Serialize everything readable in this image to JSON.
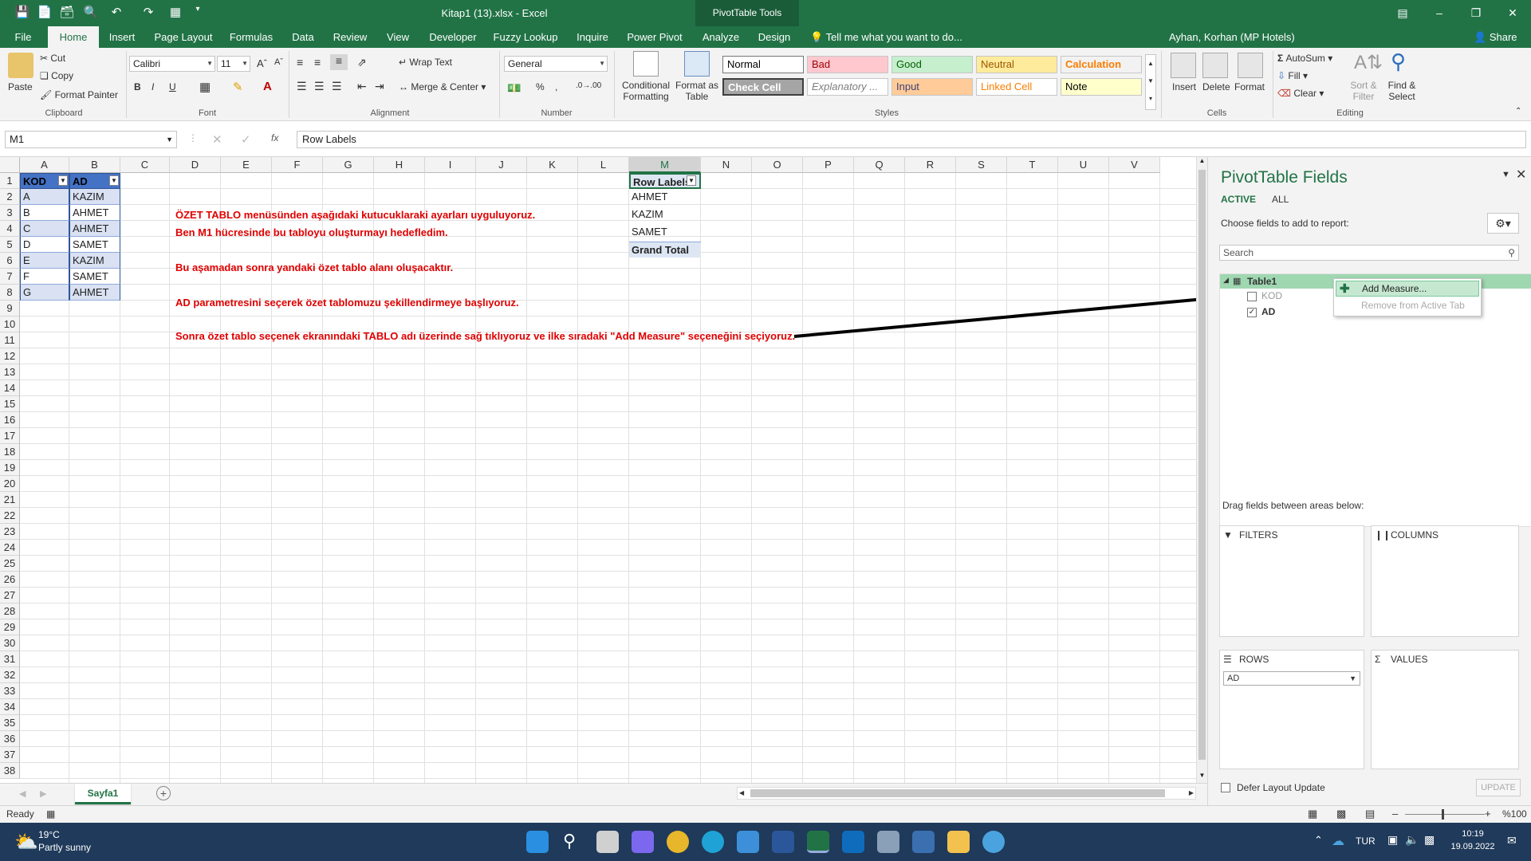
{
  "window": {
    "title": "Kitap1 (13).xlsx - Excel",
    "context_tab": "PivotTable Tools",
    "user": "Ayhan, Korhan (MP Hotels)",
    "share": "Share"
  },
  "ribbon_tabs": [
    "File",
    "Home",
    "Insert",
    "Page Layout",
    "Formulas",
    "Data",
    "Review",
    "View",
    "Developer",
    "Fuzzy Lookup",
    "Inquire",
    "Power Pivot",
    "Analyze",
    "Design"
  ],
  "tellme_placeholder": "Tell me what you want to do...",
  "ribbon": {
    "clipboard": {
      "paste": "Paste",
      "cut": "Cut",
      "copy": "Copy",
      "format_painter": "Format Painter",
      "label": "Clipboard"
    },
    "font": {
      "name": "Calibri",
      "size": "11",
      "label": "Font",
      "bold": "B",
      "italic": "I",
      "underline": "U"
    },
    "alignment": {
      "wrap": "Wrap Text",
      "merge": "Merge & Center",
      "label": "Alignment"
    },
    "number": {
      "format": "General",
      "percent": "%",
      "comma": ",",
      "label": "Number"
    },
    "styles": {
      "conditional": "Conditional Formatting",
      "format_table": "Format as Table",
      "label": "Styles",
      "cells": [
        {
          "name": "Normal",
          "bg": "#ffffff",
          "fg": "#000000"
        },
        {
          "name": "Bad",
          "bg": "#ffc7ce",
          "fg": "#9c0006"
        },
        {
          "name": "Good",
          "bg": "#c6efce",
          "fg": "#006100"
        },
        {
          "name": "Neutral",
          "bg": "#ffeb9c",
          "fg": "#9c5700"
        },
        {
          "name": "Calculation",
          "bg": "#f2f2f2",
          "fg": "#fa7d00"
        },
        {
          "name": "Check Cell",
          "bg": "#a5a5a5",
          "fg": "#ffffff"
        },
        {
          "name": "Explanatory ...",
          "bg": "#ffffff",
          "fg": "#7f7f7f"
        },
        {
          "name": "Input",
          "bg": "#ffcc99",
          "fg": "#3f3f76"
        },
        {
          "name": "Linked Cell",
          "bg": "#ffffff",
          "fg": "#fa7d00"
        },
        {
          "name": "Note",
          "bg": "#ffffcc",
          "fg": "#000000"
        }
      ]
    },
    "cells": {
      "insert": "Insert",
      "delete": "Delete",
      "format": "Format",
      "label": "Cells"
    },
    "editing": {
      "autosum": "AutoSum",
      "fill": "Fill",
      "clear": "Clear",
      "sort": "Sort & Filter",
      "find": "Find & Select",
      "label": "Editing"
    }
  },
  "formula_bar": {
    "name_box": "M1",
    "fx": "fx",
    "formula": "Row Labels"
  },
  "columns": [
    "A",
    "B",
    "C",
    "D",
    "E",
    "F",
    "G",
    "H",
    "I",
    "J",
    "K",
    "L",
    "M",
    "N",
    "O",
    "P",
    "Q",
    "R",
    "S",
    "T",
    "U",
    "V"
  ],
  "rows": [
    "1",
    "2",
    "3",
    "4",
    "5",
    "6",
    "7",
    "8",
    "9",
    "10",
    "11",
    "12",
    "13",
    "14",
    "15",
    "16",
    "17",
    "18",
    "19",
    "20",
    "21",
    "22",
    "23",
    "24",
    "25",
    "26",
    "27",
    "28",
    "29",
    "30",
    "31",
    "32",
    "33",
    "34",
    "35",
    "36",
    "37",
    "38"
  ],
  "table": {
    "headers": [
      "KOD",
      "AD"
    ],
    "rows": [
      [
        "A",
        "KAZIM"
      ],
      [
        "B",
        "AHMET"
      ],
      [
        "C",
        "AHMET"
      ],
      [
        "D",
        "SAMET"
      ],
      [
        "E",
        "KAZIM"
      ],
      [
        "F",
        "SAMET"
      ],
      [
        "G",
        "AHMET"
      ]
    ]
  },
  "pivot_table": {
    "header": "Row Labels",
    "items": [
      "AHMET",
      "KAZIM",
      "SAMET"
    ],
    "total": "Grand Total"
  },
  "notes": [
    "ÖZET TABLO menüsünden aşağıdaki kutucuklaraki ayarları uyguluyoruz.",
    "Ben M1 hücresinde bu tabloyu oluşturmayı hedefledim.",
    "Bu aşamadan sonra yandaki özet tablo alanı oluşacaktır.",
    "AD parametresini seçerek özet tablomuzu şekillendirmeye başlıyoruz.",
    "Sonra özet tablo seçenek ekranındaki TABLO adı üzerinde sağ tıklıyoruz ve ilke sıradaki \"Add Measure\" seçeneğini seçiyoruz."
  ],
  "sheet_tab": "Sayfa1",
  "status": {
    "ready": "Ready",
    "zoom": "%100"
  },
  "pivot_pane": {
    "title": "PivotTable Fields",
    "tab_active": "ACTIVE",
    "tab_all": "ALL",
    "choose": "Choose fields to add to report:",
    "search_placeholder": "Search",
    "table_name": "Table1",
    "field_kod": "KOD",
    "field_ad": "AD",
    "drag_label": "Drag fields between areas below:",
    "filters": "FILTERS",
    "columns": "COLUMNS",
    "rows": "ROWS",
    "values": "VALUES",
    "row_item": "AD",
    "defer": "Defer Layout Update",
    "update": "UPDATE"
  },
  "context_menu": {
    "add_measure": "Add Measure...",
    "remove": "Remove from Active Tab"
  },
  "taskbar": {
    "temp": "19°C",
    "weather": "Partly sunny",
    "lang": "TUR",
    "time": "10:19",
    "date": "19.09.2022"
  }
}
